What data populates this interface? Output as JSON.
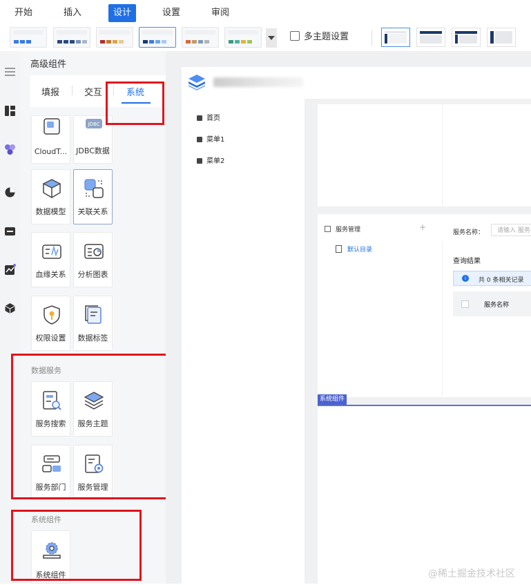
{
  "menubar": {
    "items": [
      "开始",
      "插入",
      "设计",
      "设置",
      "审阅"
    ],
    "active": "设计"
  },
  "toolbar": {
    "theme_thumbnails": [
      {
        "swatches": [
          "#3a7be0",
          "#3a7be0",
          "#3a7be0"
        ]
      },
      {
        "swatches": [
          "#2b4a7a",
          "#2b4a7a",
          "#2b4a7a",
          "#7f93b8",
          "#a8b7cf"
        ]
      },
      {
        "swatches": [
          "#b22e2e",
          "#c47a2c",
          "#d9a54a",
          "#e6c98a"
        ]
      },
      {
        "swatches": [
          "#1d3a6b",
          "#3a7be0",
          "#6fa8ea",
          "#a9c9f1"
        ]
      },
      {
        "swatches": [
          "#d46b3b",
          "#c09a6b",
          "#7d9ab8",
          "#b3b3b3"
        ]
      },
      {
        "swatches": [
          "#3b9a7a",
          "#4bb3a0",
          "#e0b33a",
          "#a0c45a"
        ]
      }
    ],
    "multi_theme_label": "多主题设置",
    "layout_thumbnails": [
      "layout-left-nav",
      "layout-top-nav",
      "layout-top-left-nav",
      "layout-left-bar"
    ]
  },
  "panel": {
    "title": "高级组件",
    "tabs": [
      "填报",
      "交互",
      "系统"
    ],
    "active_tab": "系统",
    "system_cards": [
      {
        "label": "CloudT...",
        "icon": "cloud-table-icon"
      },
      {
        "label": "JDBC数据",
        "icon": "jdbc-icon"
      },
      {
        "label": "数据模型",
        "icon": "data-model-icon"
      },
      {
        "label": "关联关系",
        "icon": "relation-icon"
      },
      {
        "label": "血缘关系",
        "icon": "lineage-icon"
      },
      {
        "label": "分析图表",
        "icon": "analysis-chart-icon"
      },
      {
        "label": "权限设置",
        "icon": "permission-icon"
      },
      {
        "label": "数据标签",
        "icon": "data-tag-icon"
      }
    ],
    "data_service_section": "数据服务",
    "data_service_cards": [
      {
        "label": "服务搜索",
        "icon": "service-search-icon"
      },
      {
        "label": "服务主题",
        "icon": "service-theme-icon"
      },
      {
        "label": "服务部门",
        "icon": "service-department-icon"
      },
      {
        "label": "服务管理",
        "icon": "service-management-icon"
      }
    ],
    "system_component_section": "系统组件",
    "system_component_cards": [
      {
        "label": "系统组件",
        "icon": "system-component-icon"
      }
    ]
  },
  "canvas": {
    "nav_items": [
      "首页",
      "菜单1",
      "菜单2"
    ],
    "service_tree_title": "服务管理",
    "service_tree_child": "默认目录",
    "search_label": "服务名称：",
    "search_placeholder": "请输入 服务名称",
    "result_title": "查询结果",
    "info_text": "共 0 条相关记录",
    "table_header": "服务名称",
    "system_component_tag": "系统组件"
  },
  "watermark": "@稀土掘金技术社区"
}
